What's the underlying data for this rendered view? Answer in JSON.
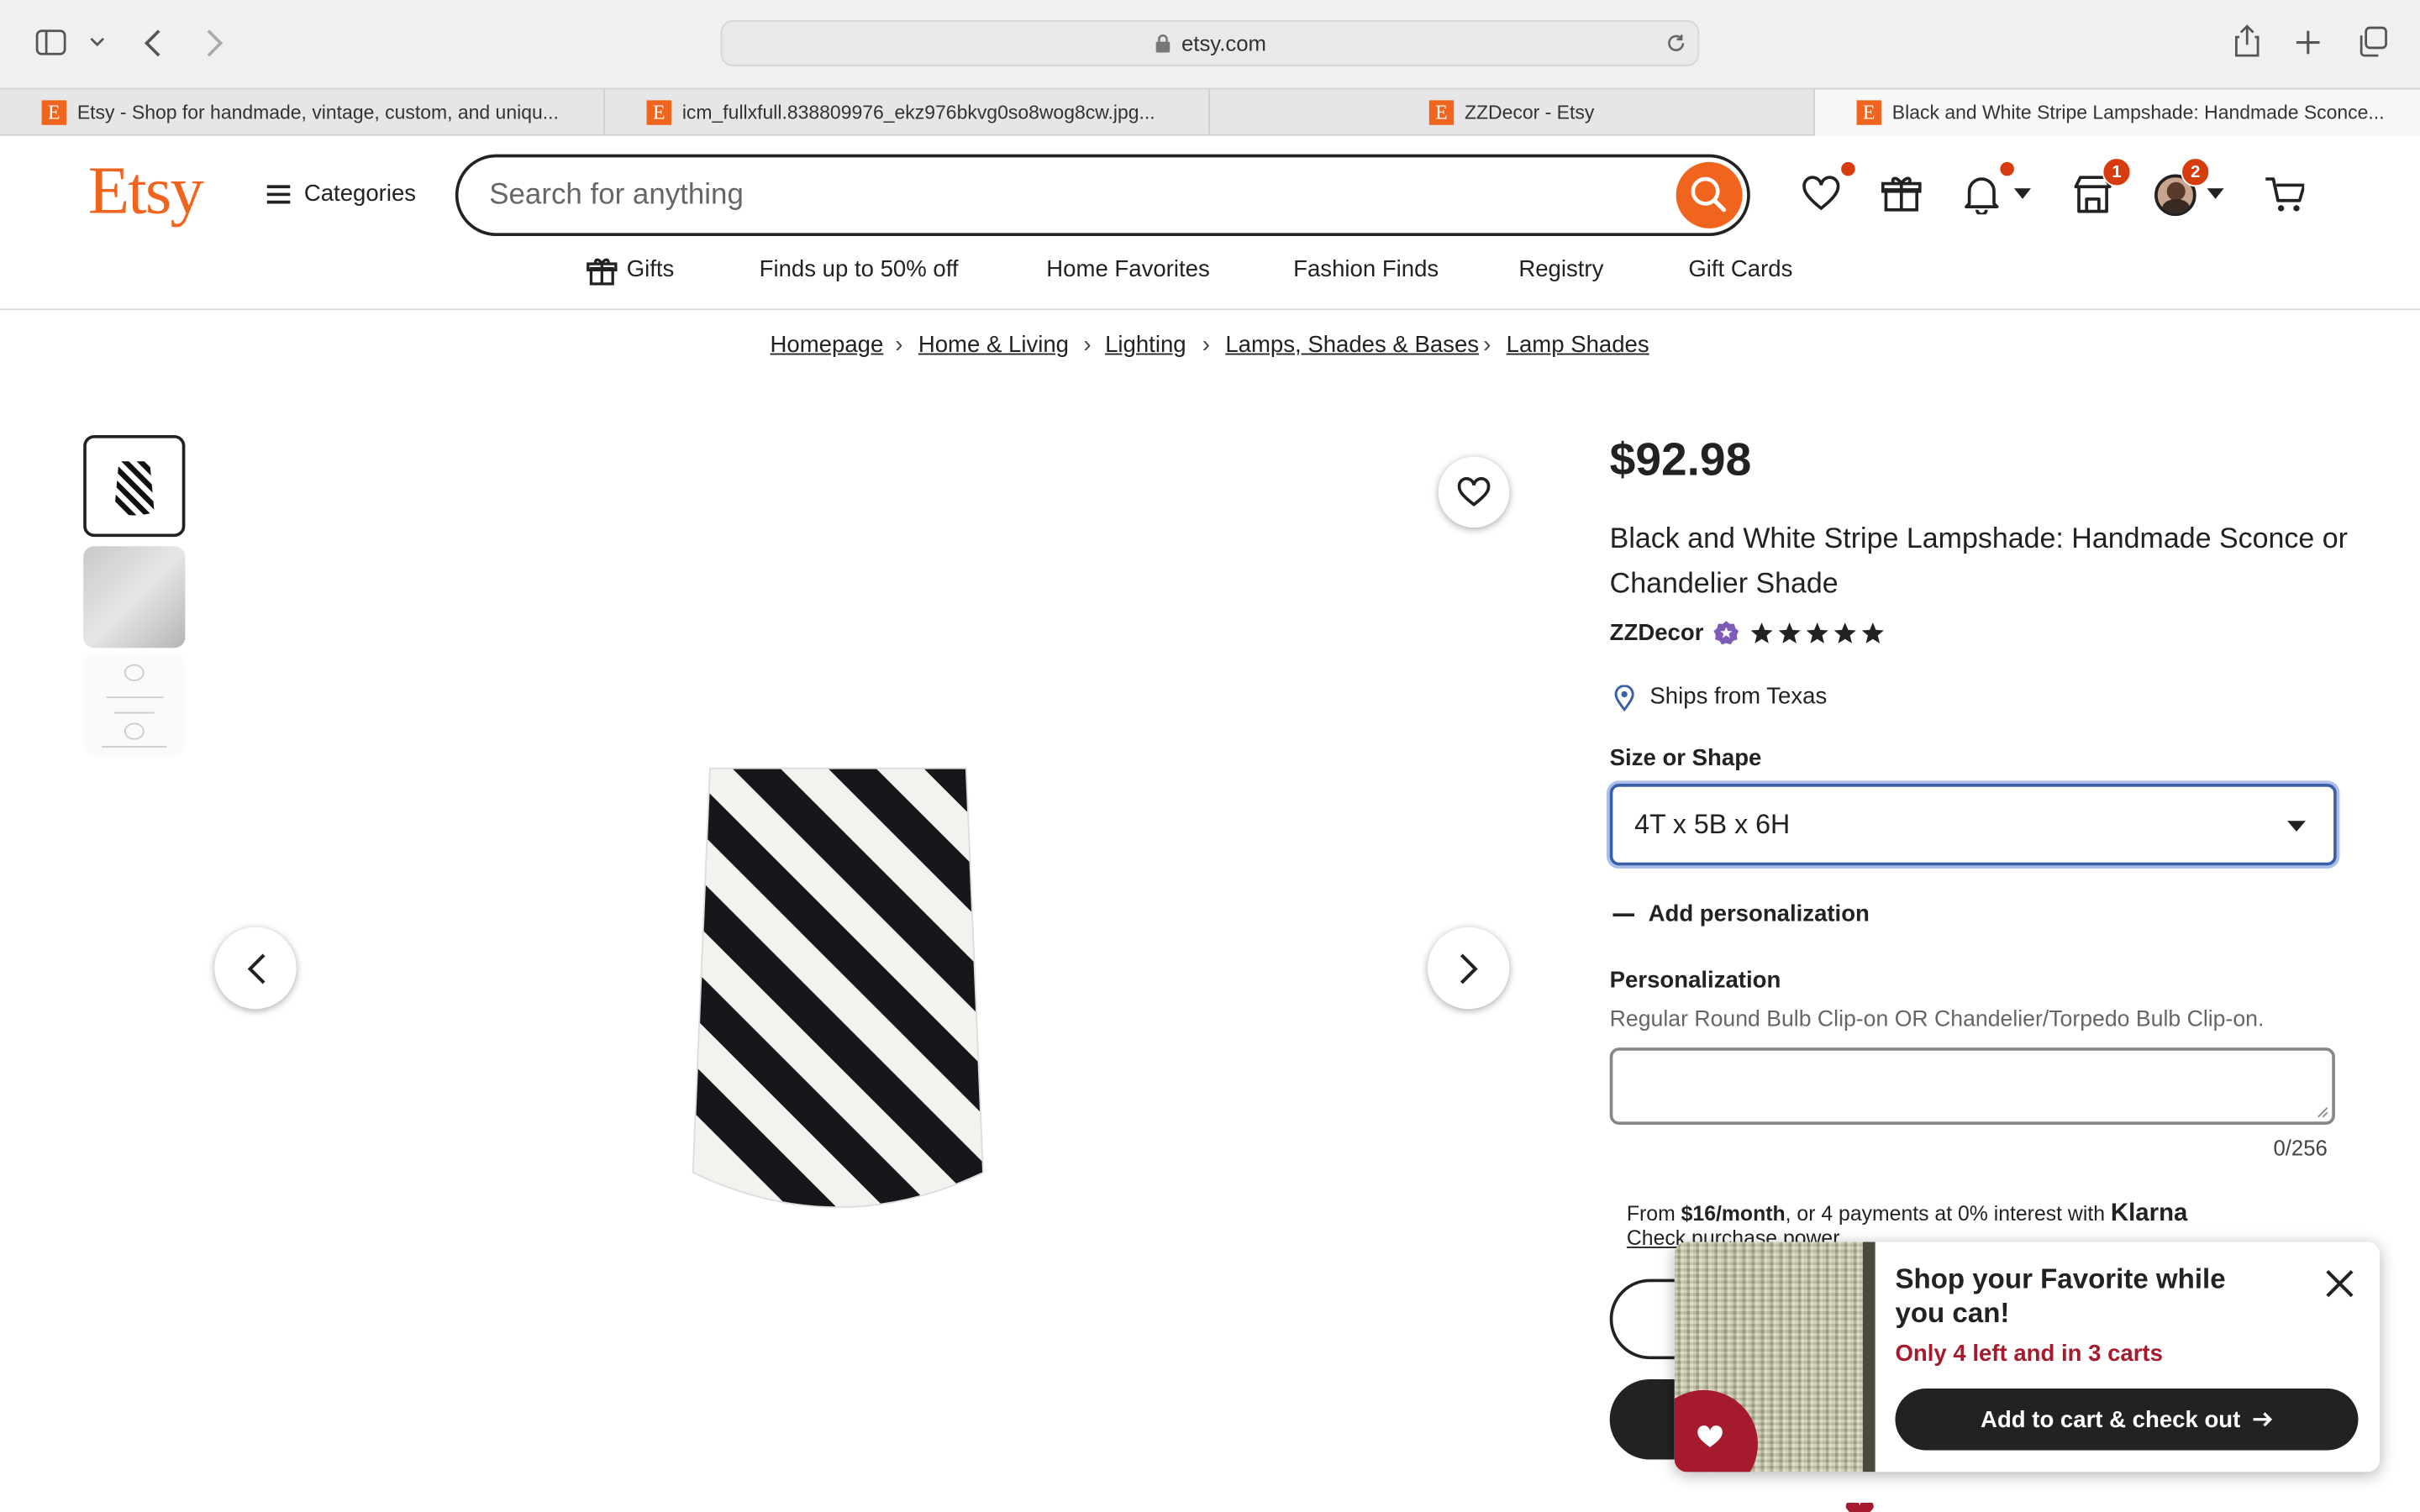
{
  "browser": {
    "url": "etsy.com",
    "tabs": [
      {
        "title": "Etsy - Shop for handmade, vintage, custom, and uniqu..."
      },
      {
        "title": "icm_fullxfull.838809976_ekz976bkvg0so8wog8cw.jpg..."
      },
      {
        "title": "ZZDecor - Etsy"
      },
      {
        "title": "Black and White Stripe Lampshade: Handmade Sconce..."
      }
    ]
  },
  "header": {
    "logo": "Etsy",
    "categories_label": "Categories",
    "search_placeholder": "Search for anything",
    "cart_badge": "1",
    "account_badge": "2"
  },
  "nav": {
    "items": [
      "Gifts",
      "Finds up to 50% off",
      "Home Favorites",
      "Fashion Finds",
      "Registry",
      "Gift Cards"
    ]
  },
  "breadcrumb": [
    "Homepage",
    "Home & Living",
    "Lighting",
    "Lamps, Shades & Bases",
    "Lamp Shades"
  ],
  "product": {
    "price": "$92.98",
    "title": "Black and White Stripe Lampshade: Handmade Sconce or Chandelier Shade",
    "shop": "ZZDecor",
    "rating_stars": 5,
    "ships_from": "Ships from Texas",
    "size_label": "Size or Shape",
    "size_value": "4T x 5B x 6H",
    "add_personalization": "Add personalization",
    "personalization_label": "Personalization",
    "personalization_hint": "Regular Round Bulb Clip-on OR Chandelier/Torpedo Bulb Clip-on.",
    "char_count": "0/256",
    "klarna_from": "From ",
    "klarna_amount": "$16/month",
    "klarna_rest": ", or 4 payments at 0% interest with ",
    "klarna_brand": "Klarna",
    "klarna_link": "Check purchase power"
  },
  "popup": {
    "title": "Shop your Favorite while you can!",
    "urgency": "Only 4 left and in 3 carts",
    "cta": "Add to cart & check out"
  },
  "colors": {
    "brand": "#f1641e",
    "urgency": "#a61a2e",
    "focus": "#3a5fa8"
  }
}
